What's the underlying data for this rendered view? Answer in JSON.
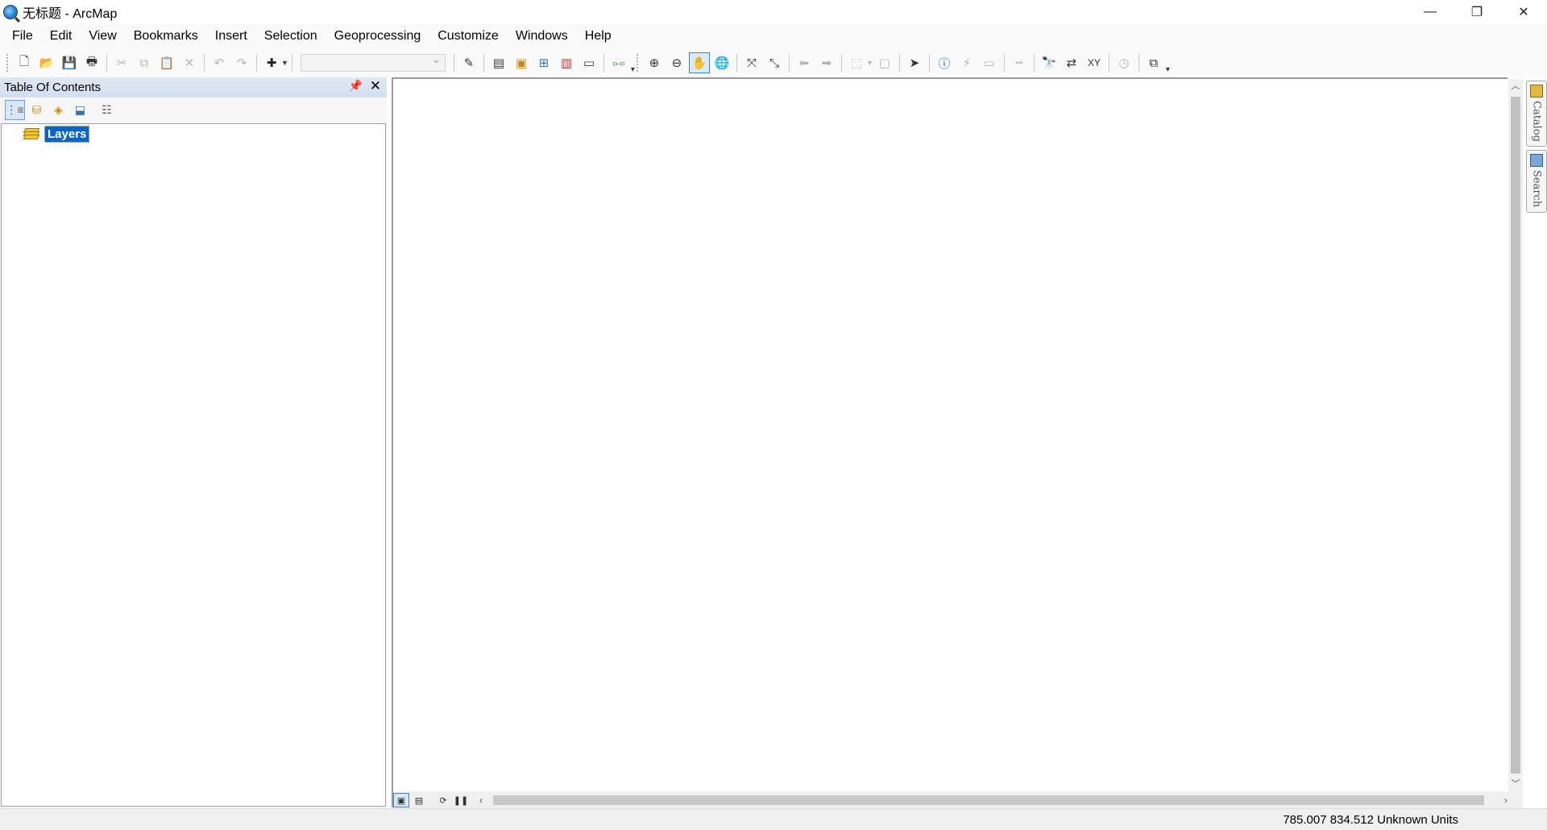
{
  "window": {
    "title": "无标题 - ArcMap",
    "minimize_glyph": "—",
    "restore_glyph": "❐",
    "close_glyph": "✕"
  },
  "menu": [
    "File",
    "Edit",
    "View",
    "Bookmarks",
    "Insert",
    "Selection",
    "Geoprocessing",
    "Customize",
    "Windows",
    "Help"
  ],
  "toolbar": {
    "scale_value": "",
    "icons": [
      "new-document-icon",
      "open-folder-icon",
      "save-icon",
      "print-icon",
      "cut-icon",
      "copy-icon",
      "paste-icon",
      "delete-icon",
      "undo-icon",
      "redo-icon",
      "add-data-icon",
      "editor-toolbar-icon",
      "table-of-contents-icon",
      "catalog-window-icon",
      "search-window-icon",
      "arctoolbox-icon",
      "python-window-icon",
      "model-builder-icon",
      "zoom-in-icon",
      "zoom-out-icon",
      "pan-icon",
      "full-extent-icon",
      "fixed-zoom-in-icon",
      "fixed-zoom-out-icon",
      "back-extent-icon",
      "forward-extent-icon",
      "select-features-icon",
      "clear-selection-icon",
      "select-elements-icon",
      "identify-icon",
      "hyperlink-icon",
      "html-popup-icon",
      "measure-icon",
      "find-icon",
      "find-route-icon",
      "go-to-xy-icon",
      "time-slider-icon",
      "create-viewer-window-icon"
    ]
  },
  "toc": {
    "title": "Table Of Contents",
    "layers_label": "Layers",
    "pin_glyph": "📌",
    "close_glyph": "✕"
  },
  "side_tabs": {
    "catalog": "Catalog",
    "search": "Search"
  },
  "status": {
    "coordinates": "785.007  834.512 Unknown Units"
  },
  "colors": {
    "selection_blue": "#0a64c8",
    "toc_header": "#d3dfee"
  }
}
